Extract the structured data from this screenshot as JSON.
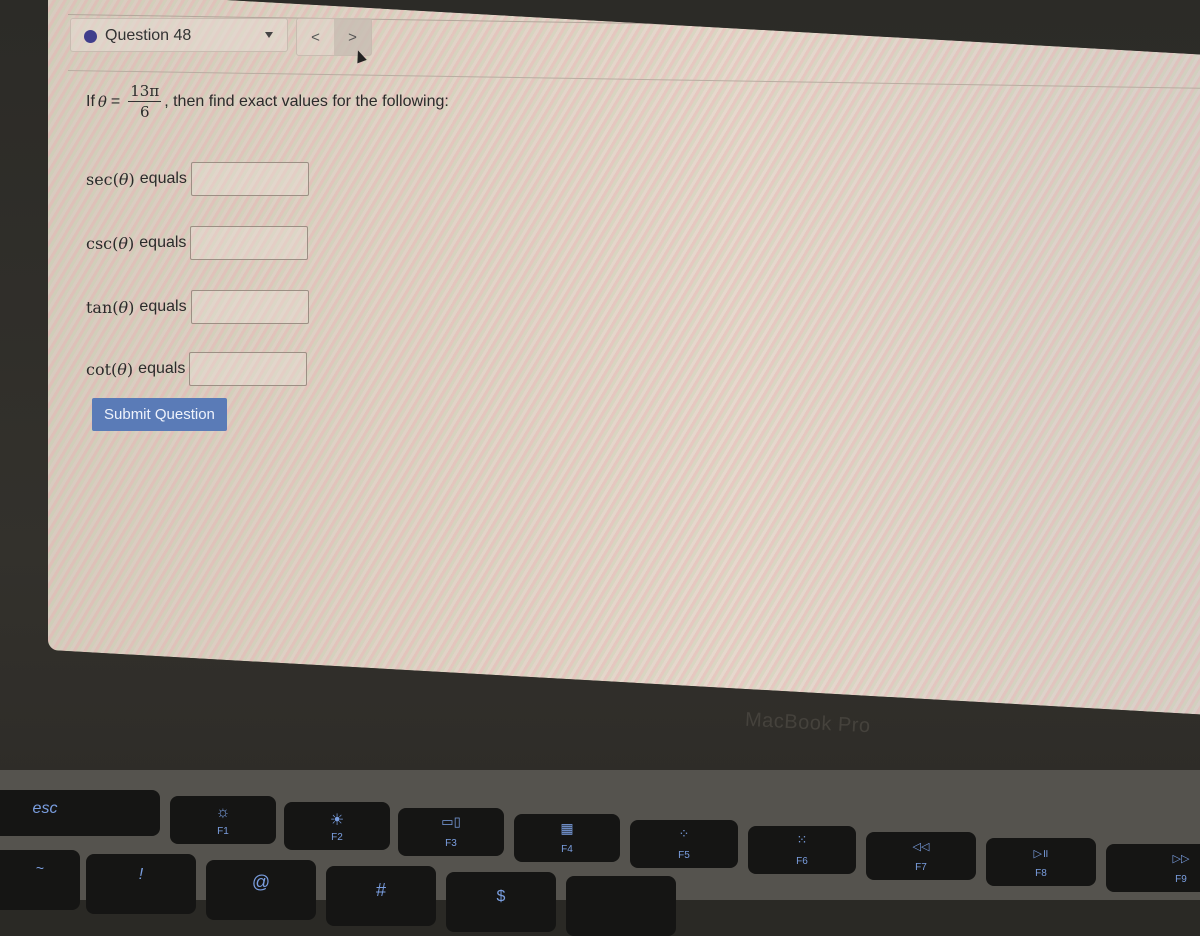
{
  "header": {
    "question_label": "Question 48",
    "dot_color": "#3f3e8c",
    "prev_glyph": "<",
    "next_glyph": ">"
  },
  "prompt": {
    "prefix": "If",
    "variable": "θ",
    "equals": "=",
    "numerator": "13π",
    "denominator": "6",
    "suffix": ", then find exact values for the following:"
  },
  "rows": [
    {
      "fn": "sec",
      "arg": "θ",
      "label": "equals",
      "value": ""
    },
    {
      "fn": "csc",
      "arg": "θ",
      "label": "equals",
      "value": ""
    },
    {
      "fn": "tan",
      "arg": "θ",
      "label": "equals",
      "value": ""
    },
    {
      "fn": "cot",
      "arg": "θ",
      "label": "equals",
      "value": ""
    }
  ],
  "submit": {
    "label": "Submit Question",
    "color": "#5a7bb7"
  },
  "device": {
    "brand": "MacBook Pro"
  },
  "keys": {
    "esc": "esc",
    "f1": "F1",
    "f2": "F2",
    "f3": "F3",
    "f4": "F4",
    "f5": "F5",
    "f6": "F6",
    "f7": "F7",
    "f8": "F8",
    "f9": "F9",
    "tilde": "~",
    "excl": "!",
    "at": "@",
    "hash": "#",
    "dollar": "$",
    "icons": {
      "f1": "☼",
      "f2": "☀",
      "f3": "▭▯",
      "f4": "▦",
      "f5": "⁘",
      "f6": "⁙",
      "f7": "◁◁",
      "f8": "▷॥",
      "f9": "▷▷"
    }
  }
}
